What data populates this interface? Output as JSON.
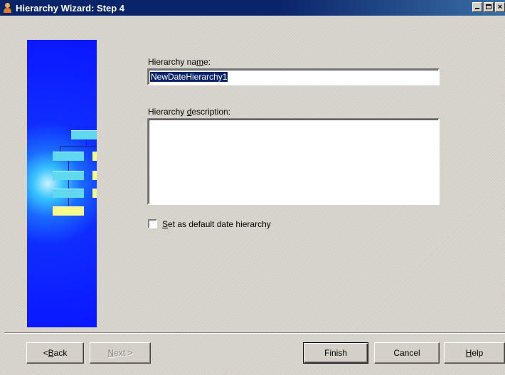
{
  "window": {
    "title": "Hierarchy Wizard: Step 4",
    "controls": [
      "minimize",
      "maximize",
      "close"
    ]
  },
  "form": {
    "name_label_prefix": "Hierarchy na",
    "name_label_accel": "m",
    "name_label_suffix": "e:",
    "name_value": "NewDateHierarchy1",
    "description_label_prefix": "Hierarchy ",
    "description_label_accel": "d",
    "description_label_suffix": "escription:",
    "description_value": "",
    "default_checkbox_accel": "S",
    "default_checkbox_label": "et as default date hierarchy",
    "default_checked": false
  },
  "buttons": {
    "back_accel": "B",
    "back_suffix": "ack",
    "back_prefix": "< ",
    "next_accel": "N",
    "next_suffix": "ext >",
    "finish": "Finish",
    "cancel": "Cancel",
    "help_accel": "H",
    "help_suffix": "elp"
  },
  "side_image": {
    "icon": "hierarchy-illustration",
    "accent": "#0a16ff"
  },
  "colors": {
    "title_bar": "#0a246a",
    "face": "#d4d0c8",
    "selection": "#0a246a"
  }
}
